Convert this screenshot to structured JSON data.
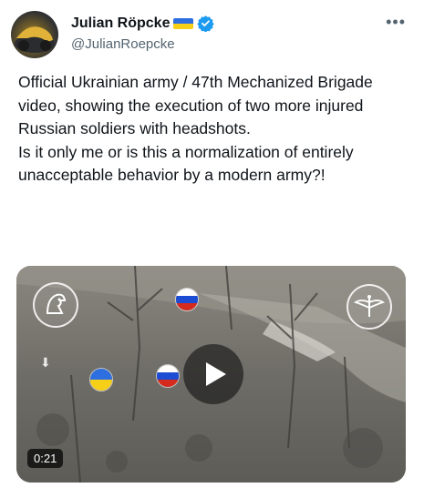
{
  "user": {
    "display_name": "Julian Röpcke",
    "handle": "@JulianRoepcke"
  },
  "tweet": {
    "paragraphs": [
      "Official Ukrainian army / 47th Mechanized Brigade video, showing the execution of two more injured Russian soldiers with headshots.",
      "Is it only me or is this a normalization of entirely unacceptable behavior by a modern army?!"
    ]
  },
  "media": {
    "duration": "0:21"
  },
  "icons": {
    "more": "more-dots-icon",
    "verified": "verified-badge-icon",
    "play": "play-icon",
    "flag": "ukraine-flag-icon"
  },
  "colors": {
    "verified_blue": "#1d9bf0",
    "text": "#0f1419",
    "muted": "#536471",
    "flag_blue": "#2d6fe0",
    "flag_yellow": "#f6cf18"
  }
}
